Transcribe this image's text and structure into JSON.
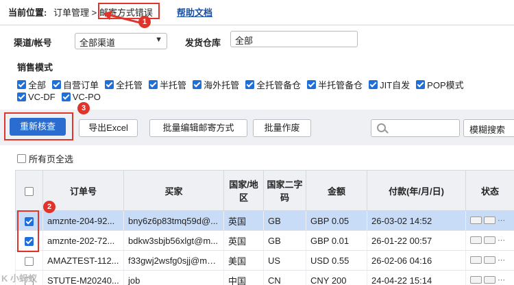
{
  "breadcrumb": {
    "label": "当前位置:",
    "path": "订单管理 > 邮寄方式错误",
    "help": "帮助文档"
  },
  "filters": {
    "channel_label": "渠道/帐号",
    "channel_value": "全部渠道",
    "warehouse_label": "发货仓库",
    "warehouse_value": "全部",
    "sales_mode_label": "销售模式",
    "sales_modes": [
      "全部",
      "自营订单",
      "全托管",
      "半托管",
      "海外托管",
      "全托管备仓",
      "半托管备仓",
      "JIT自发",
      "POP模式",
      "VC-DF",
      "VC-PO"
    ]
  },
  "toolbar": {
    "recheck": "重新核查",
    "export": "导出Excel",
    "batch_edit": "批量编辑邮寄方式",
    "batch_void": "批量作废",
    "search_placeholder": "",
    "fuzzy": "模糊搜索"
  },
  "select_all_pages": "所有页全选",
  "table": {
    "headers": [
      "",
      "订单号",
      "买家",
      "国家/地区",
      "国家二字码",
      "金额",
      "付款(年/月/日)",
      "状态"
    ],
    "rows": [
      {
        "checked": true,
        "order": "amznte-204-92...",
        "buyer": "bny6z6p83tmq59d@...",
        "country": "英国",
        "code": "GB",
        "amount": "GBP 0.05",
        "paid": "26-03-02 14:52"
      },
      {
        "checked": true,
        "order": "amznte-202-72...",
        "buyer": "bdkw3sbjb56xlgt@m...",
        "country": "英国",
        "code": "GB",
        "amount": "GBP 0.01",
        "paid": "26-01-22 00:57"
      },
      {
        "checked": false,
        "order": "AMAZTEST-112...",
        "buyer": "f33gwj2wsfg0sjj@ma...",
        "country": "美国",
        "code": "US",
        "amount": "USD 0.55",
        "paid": "26-02-06 04:16"
      },
      {
        "checked": false,
        "order": "STUTE-M20240...",
        "buyer": "job",
        "country": "中国",
        "code": "CN",
        "amount": "CNY 200",
        "paid": "24-04-22 15:14"
      }
    ]
  },
  "markers": [
    "1",
    "2",
    "3"
  ],
  "watermark": "K 小蚂蚁"
}
